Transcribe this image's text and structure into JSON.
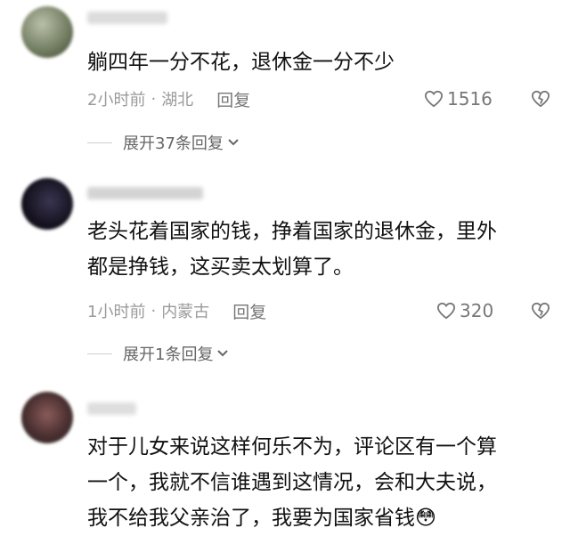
{
  "comments": [
    {
      "text": "躺四年一分不花，退休金一分不少",
      "time": "2小时前",
      "location": "湖北",
      "reply_label": "回复",
      "likes": "1516",
      "expand_label": "展开37条回复"
    },
    {
      "text_line1": "老头花着国家的钱，挣着国家的退休金，里外",
      "text_line2": "都是挣钱，这买卖太划算了。",
      "time": "1小时前",
      "location": "内蒙古",
      "reply_label": "回复",
      "likes": "320",
      "expand_label": "展开1条回复"
    },
    {
      "text_line1": "对于儿女来说这样何乐不为，评论区有一个算",
      "text_line2": "一个，我就不信谁遇到这情况，会和大夫说，",
      "text_line3": "我不给我父亲治了，我要为国家省钱😳"
    }
  ],
  "separator": "·",
  "colors": {
    "meta": "#9a9a9a",
    "icon": "#777777",
    "text": "#111111"
  },
  "icons": {
    "like": "heart-icon",
    "dislike": "broken-heart-icon",
    "expand": "chevron-down-icon"
  }
}
